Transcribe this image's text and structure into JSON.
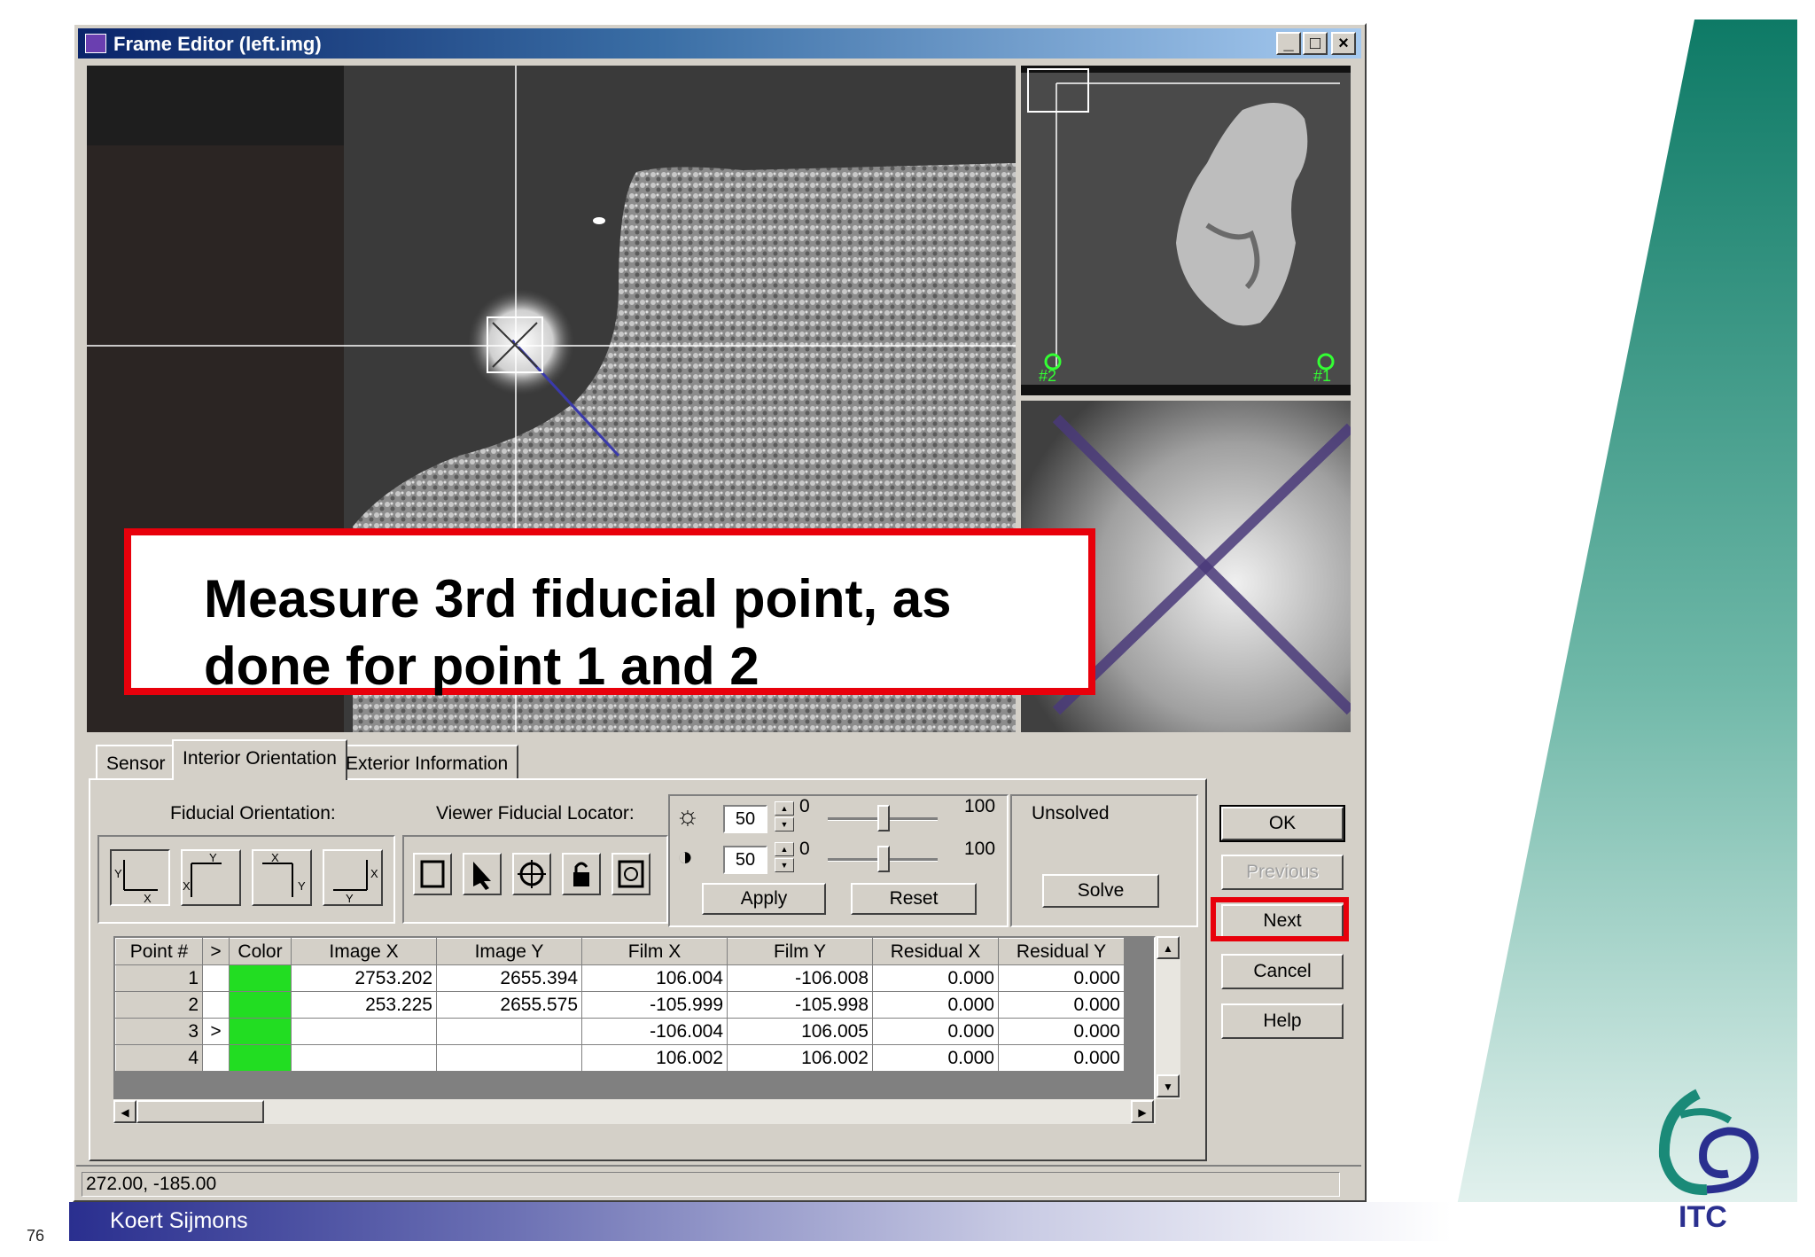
{
  "window": {
    "title": "Frame Editor (left.img)",
    "minimize_label": "_",
    "maximize_label": "□",
    "close_label": "×"
  },
  "callout": {
    "text": "Measure 3rd fiducial point, as done for point 1 and 2"
  },
  "overview": {
    "marker_2": "#2",
    "marker_1": "#1"
  },
  "tabs": [
    {
      "label": "Sensor"
    },
    {
      "label": "Interior Orientation"
    },
    {
      "label": "Exterior Information"
    }
  ],
  "panel": {
    "fiducial_orientation_label": "Fiducial Orientation:",
    "viewer_locator_label": "Viewer Fiducial Locator:",
    "brightness_value": "50",
    "brightness_min": "0",
    "brightness_max": "100",
    "contrast_value": "50",
    "contrast_min": "0",
    "contrast_max": "100",
    "apply_label": "Apply",
    "reset_label": "Reset",
    "status_label": "Unsolved",
    "solve_label": "Solve"
  },
  "dialog_buttons": {
    "ok": "OK",
    "previous": "Previous",
    "next": "Next",
    "cancel": "Cancel",
    "help": "Help"
  },
  "table": {
    "columns": [
      "Point #",
      ">",
      "Color",
      "Image X",
      "Image Y",
      "Film X",
      "Film Y",
      "Residual X",
      "Residual Y"
    ],
    "rows": [
      {
        "point": "1",
        "marker": "",
        "image_x": "2753.202",
        "image_y": "2655.394",
        "film_x": "106.004",
        "film_y": "-106.008",
        "res_x": "0.000",
        "res_y": "0.000"
      },
      {
        "point": "2",
        "marker": "",
        "image_x": "253.225",
        "image_y": "2655.575",
        "film_x": "-105.999",
        "film_y": "-105.998",
        "res_x": "0.000",
        "res_y": "0.000"
      },
      {
        "point": "3",
        "marker": ">",
        "image_x": "",
        "image_y": "",
        "film_x": "-106.004",
        "film_y": "106.005",
        "res_x": "0.000",
        "res_y": "0.000"
      },
      {
        "point": "4",
        "marker": "",
        "image_x": "",
        "image_y": "",
        "film_x": "106.002",
        "film_y": "106.002",
        "res_x": "0.000",
        "res_y": "0.000"
      }
    ]
  },
  "status_bar": {
    "coordinates": "272.00, -185.00"
  },
  "slide": {
    "author": "Koert Sijmons",
    "page_number": "76",
    "logo_text": "ITC"
  },
  "colors": {
    "highlight_red": "#e8000b",
    "fiducial_color": "#22dd22",
    "teal": "#1a8a78",
    "footer_blue": "#2a2f8f"
  }
}
